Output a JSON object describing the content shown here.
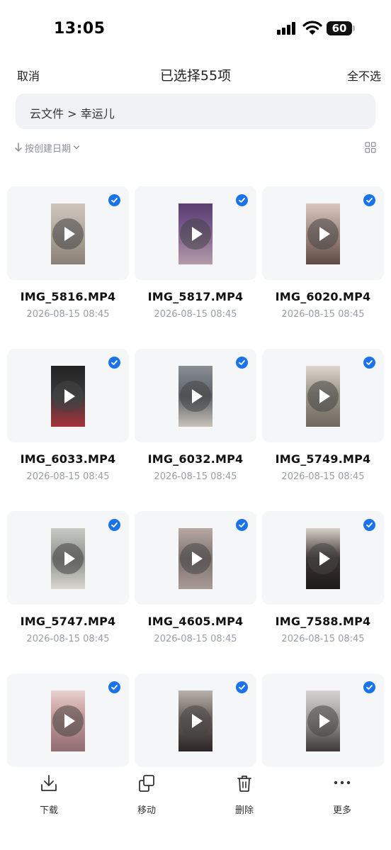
{
  "status_bar": {
    "time": "13:05",
    "battery": "60"
  },
  "header": {
    "cancel": "取消",
    "title": "已选择55项",
    "deselect_all": "全不选"
  },
  "breadcrumb": {
    "path": "云文件 > 幸运儿"
  },
  "sort": {
    "label": "按创建日期"
  },
  "files": [
    {
      "name": "IMG_5816.MP4",
      "date": "2026-08-15 08:45",
      "selected": true
    },
    {
      "name": "IMG_5817.MP4",
      "date": "2026-08-15 08:45",
      "selected": true
    },
    {
      "name": "IMG_6020.MP4",
      "date": "2026-08-15 08:45",
      "selected": true
    },
    {
      "name": "IMG_6033.MP4",
      "date": "2026-08-15 08:45",
      "selected": true
    },
    {
      "name": "IMG_6032.MP4",
      "date": "2026-08-15 08:45",
      "selected": true
    },
    {
      "name": "IMG_5749.MP4",
      "date": "2026-08-15 08:45",
      "selected": true
    },
    {
      "name": "IMG_5747.MP4",
      "date": "2026-08-15 08:45",
      "selected": true
    },
    {
      "name": "IMG_4605.MP4",
      "date": "2026-08-15 08:45",
      "selected": true
    },
    {
      "name": "IMG_7588.MP4",
      "date": "2026-08-15 08:45",
      "selected": true
    },
    {
      "name": "",
      "date": "",
      "selected": true
    },
    {
      "name": "",
      "date": "",
      "selected": true
    },
    {
      "name": "",
      "date": "",
      "selected": true
    }
  ],
  "toolbar": {
    "download": "下载",
    "move": "移动",
    "delete": "删除",
    "more": "更多"
  },
  "colors": {
    "accent": "#1a73e8",
    "card_bg": "#f5f6f8",
    "muted_text": "#9a9ea6"
  }
}
